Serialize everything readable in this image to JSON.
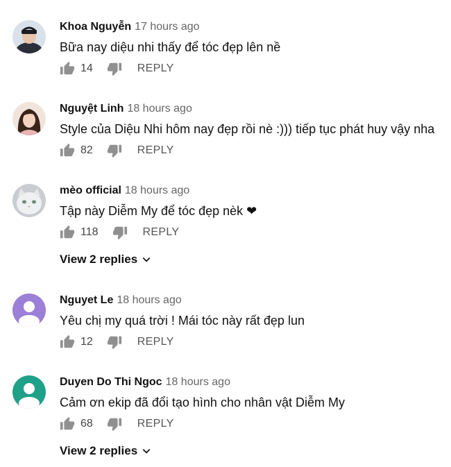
{
  "comments": [
    {
      "author": "Khoa Nguyễn",
      "time": "17 hours ago",
      "text": "Bữa nay diệu nhi thấy để tóc đẹp lên nề",
      "likes": "14",
      "reply": "REPLY"
    },
    {
      "author": "Nguyệt Linh",
      "time": "18 hours ago",
      "text": "Style của Diệu Nhi hôm nay đẹp rồi nè :))) tiếp tục phát huy vậy nha",
      "likes": "82",
      "reply": "REPLY"
    },
    {
      "author": "mèo official",
      "time": "18 hours ago",
      "text": "Tập này Diễm My để tóc đẹp nèk ❤",
      "likes": "118",
      "reply": "REPLY",
      "view_replies": "View 2 replies"
    },
    {
      "author": "Nguyet Le",
      "time": "18 hours ago",
      "text": "Yêu chị my quá trời ! Mái tóc này rất đẹp lun",
      "likes": "12",
      "reply": "REPLY"
    },
    {
      "author": "Duyen Do Thi Ngoc",
      "time": "18 hours ago",
      "text": "Cảm ơn ekip đã đổi tạo hình cho nhân vật Diễm My",
      "likes": "68",
      "reply": "REPLY",
      "view_replies": "View 2 replies"
    }
  ],
  "colors": {
    "default_avatar_purple": "#9c7fd6",
    "default_avatar_teal": "#1fa189",
    "icon_gray": "#909090"
  }
}
